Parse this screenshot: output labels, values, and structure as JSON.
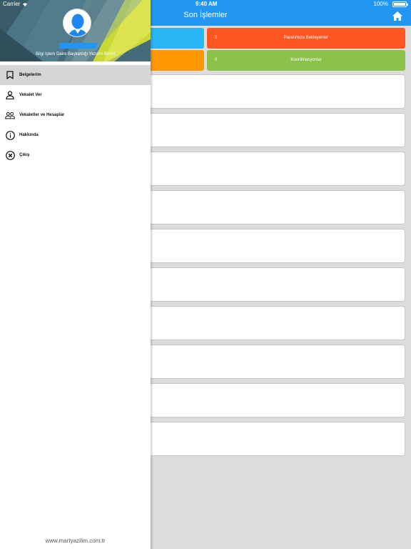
{
  "status_bar": {
    "carrier": "Carrier",
    "time": "9:40 AM",
    "battery": "100%"
  },
  "navbar": {
    "title": "Son İşlemler",
    "home_icon": "home-icon",
    "color": "#2196f3"
  },
  "tiles": [
    {
      "count": "",
      "label": "",
      "color": "#29b6f6"
    },
    {
      "count": "0",
      "label": "Parafımıza Bekleyenler",
      "color": "#ff5722"
    },
    {
      "count": "",
      "label": "",
      "color": "#ff9800"
    },
    {
      "count": "0",
      "label": "Koordinasyonlar",
      "color": "#8bc34a"
    }
  ],
  "drawer": {
    "user_dept": "Bilgi İşlem Daire Başkanlığı Yazılım Birimi",
    "menu": [
      {
        "label": "Belgelerim",
        "icon": "bookmark-icon",
        "active": true
      },
      {
        "label": "Vekalet Ver",
        "icon": "person-icon"
      },
      {
        "label": "Vekaletler ve Hesaplar",
        "icon": "people-icon"
      },
      {
        "label": "Hakkında",
        "icon": "info-icon"
      },
      {
        "label": "Çıkış",
        "icon": "close-circle-icon"
      }
    ],
    "footer": "www.martyazilim.com.tr"
  }
}
